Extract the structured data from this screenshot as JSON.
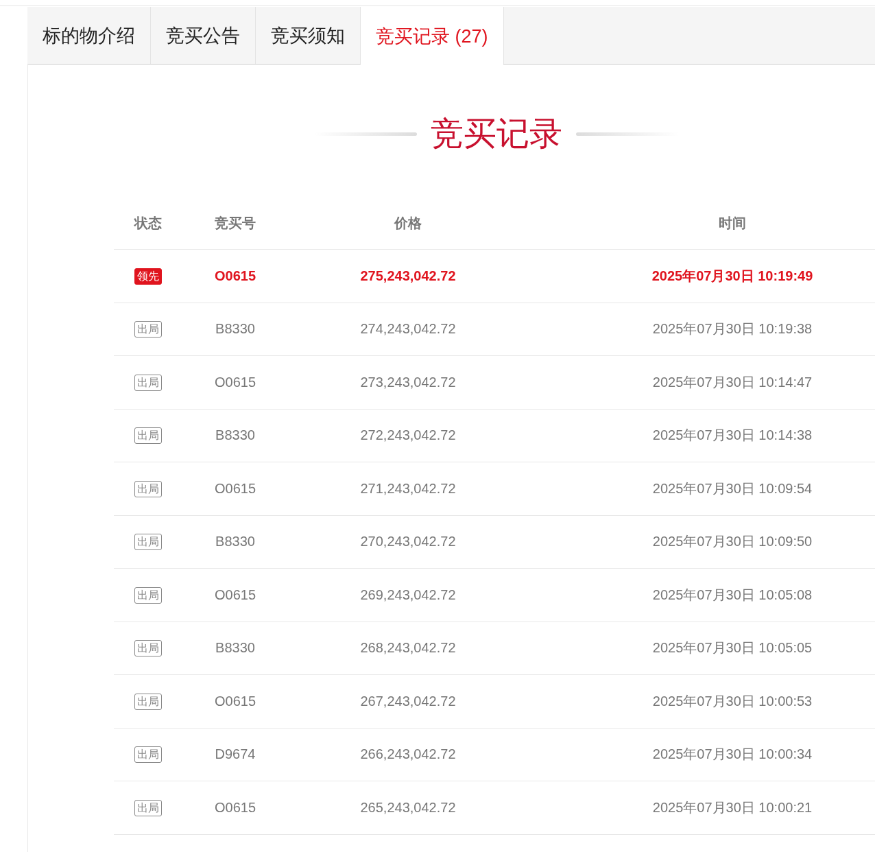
{
  "tabs": [
    {
      "label": "标的物介绍",
      "selected": false
    },
    {
      "label": "竞买公告",
      "selected": false
    },
    {
      "label": "竞买须知",
      "selected": false
    },
    {
      "label": "竞买记录 (27)",
      "selected": true
    }
  ],
  "section_title": "竞买记录",
  "table": {
    "columns": [
      "状态",
      "竞买号",
      "价格",
      "时间"
    ],
    "rows": [
      {
        "leading": true,
        "status": "领先",
        "bidder": "O0615",
        "price": "275,243,042.72",
        "time": "2025年07月30日 10:19:49"
      },
      {
        "leading": false,
        "status": "出局",
        "bidder": "B8330",
        "price": "274,243,042.72",
        "time": "2025年07月30日 10:19:38"
      },
      {
        "leading": false,
        "status": "出局",
        "bidder": "O0615",
        "price": "273,243,042.72",
        "time": "2025年07月30日 10:14:47"
      },
      {
        "leading": false,
        "status": "出局",
        "bidder": "B8330",
        "price": "272,243,042.72",
        "time": "2025年07月30日 10:14:38"
      },
      {
        "leading": false,
        "status": "出局",
        "bidder": "O0615",
        "price": "271,243,042.72",
        "time": "2025年07月30日 10:09:54"
      },
      {
        "leading": false,
        "status": "出局",
        "bidder": "B8330",
        "price": "270,243,042.72",
        "time": "2025年07月30日 10:09:50"
      },
      {
        "leading": false,
        "status": "出局",
        "bidder": "O0615",
        "price": "269,243,042.72",
        "time": "2025年07月30日 10:05:08"
      },
      {
        "leading": false,
        "status": "出局",
        "bidder": "B8330",
        "price": "268,243,042.72",
        "time": "2025年07月30日 10:05:05"
      },
      {
        "leading": false,
        "status": "出局",
        "bidder": "O0615",
        "price": "267,243,042.72",
        "time": "2025年07月30日 10:00:53"
      },
      {
        "leading": false,
        "status": "出局",
        "bidder": "D9674",
        "price": "266,243,042.72",
        "time": "2025年07月30日 10:00:34"
      },
      {
        "leading": false,
        "status": "出局",
        "bidder": "O0615",
        "price": "265,243,042.72",
        "time": "2025年07月30日 10:00:21"
      }
    ]
  }
}
